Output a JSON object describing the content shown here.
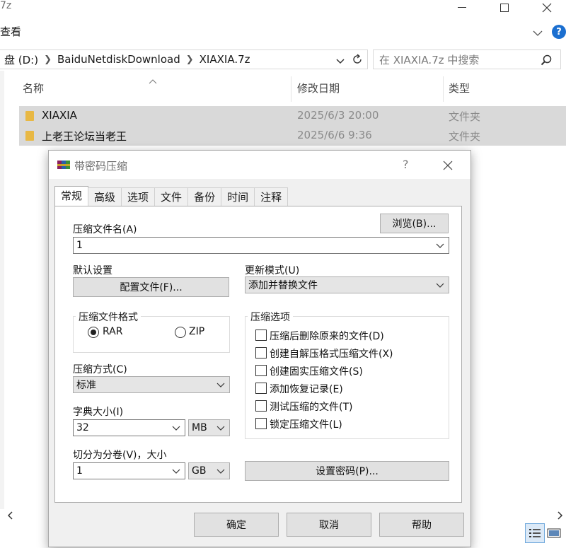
{
  "window": {
    "title_fragment": "7z",
    "menu_view": "查看",
    "breadcrumb": [
      "盘 (D:)",
      "BaiduNetdiskDownload",
      "XIAXIA.7z"
    ],
    "search_placeholder": "在 XIAXIA.7z 中搜索"
  },
  "columns": {
    "name": "名称",
    "modified": "修改日期",
    "type": "类型"
  },
  "files": [
    {
      "name": "XIAXIA",
      "modified": "2025/6/3 20:00",
      "type": "文件夹"
    },
    {
      "name": "上老王论坛当老王",
      "modified": "2025/6/6 9:36",
      "type": "文件夹"
    }
  ],
  "dialog": {
    "title": "带密码压缩",
    "help_glyph": "?",
    "tabs": [
      "常规",
      "高级",
      "选项",
      "文件",
      "备份",
      "时间",
      "注释"
    ],
    "archive_name_label": "压缩文件名(A)",
    "browse_button": "浏览(B)...",
    "archive_name_value": "1",
    "default_settings_label": "默认设置",
    "profiles_button": "配置文件(F)...",
    "update_mode_label": "更新模式(U)",
    "update_mode_value": "添加并替换文件",
    "format_group_title": "压缩文件格式",
    "format_rar": "RAR",
    "format_zip": "ZIP",
    "format_selected": "RAR",
    "options_group_title": "压缩选项",
    "options": [
      "压缩后删除原来的文件(D)",
      "创建自解压格式压缩文件(X)",
      "创建固实压缩文件(S)",
      "添加恢复记录(E)",
      "测试压缩的文件(T)",
      "锁定压缩文件(L)"
    ],
    "method_label": "压缩方式(C)",
    "method_value": "标准",
    "dict_label": "字典大小(I)",
    "dict_value": "32",
    "dict_unit": "MB",
    "split_label": "切分为分卷(V)，大小",
    "split_value": "1",
    "split_unit": "GB",
    "set_password_button": "设置密码(P)...",
    "ok_button": "确定",
    "cancel_button": "取消",
    "help_button": "帮助"
  },
  "colors": {
    "accent": "#1b6fd0",
    "selection": "#d9d9d9",
    "folder": "#e8b844"
  }
}
